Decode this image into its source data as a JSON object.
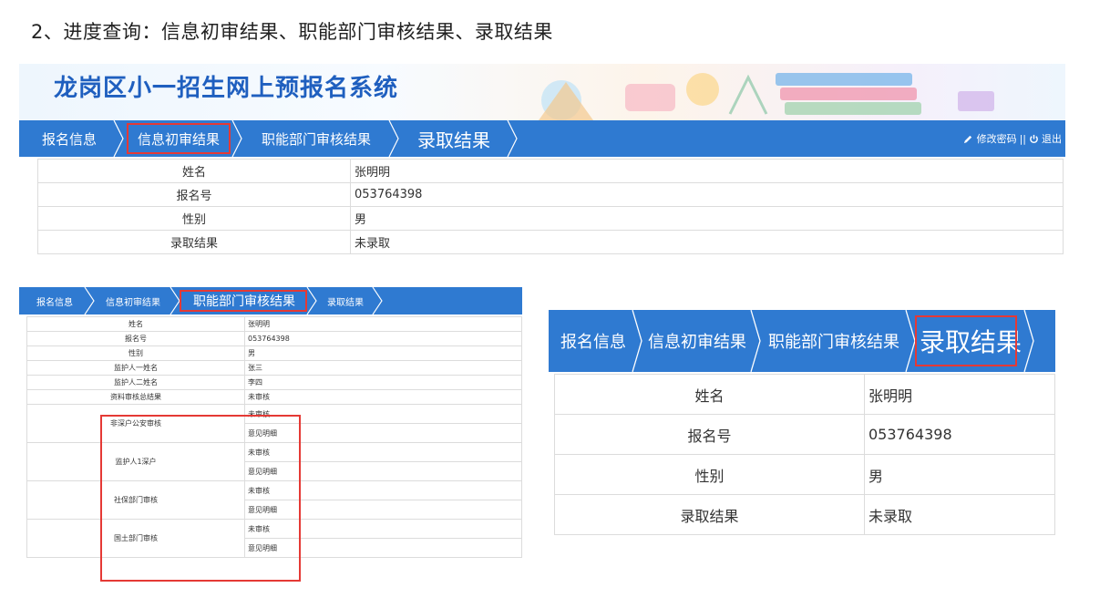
{
  "heading": "2、进度查询：信息初审结果、职能部门审核结果、录取结果",
  "system_title": "龙岗区小一招生网上预报名系统",
  "nav": {
    "tabs": [
      "报名信息",
      "信息初审结果",
      "职能部门审核结果",
      "录取结果"
    ],
    "change_password": "修改密码",
    "separator": "||",
    "logout": "退出"
  },
  "basic_info": [
    {
      "label": "姓名",
      "value": "张明明"
    },
    {
      "label": "报名号",
      "value": "053764398"
    },
    {
      "label": "性别",
      "value": "男"
    },
    {
      "label": "录取结果",
      "value": "未录取"
    }
  ],
  "dept_review": {
    "rows": [
      {
        "label": "姓名",
        "value": "张明明"
      },
      {
        "label": "报名号",
        "value": "053764398"
      },
      {
        "label": "性别",
        "value": "男"
      },
      {
        "label": "监护人一姓名",
        "value": "张三"
      },
      {
        "label": "监护人二姓名",
        "value": "李四"
      },
      {
        "label": "资料审核总结果",
        "value": "未审核"
      }
    ],
    "checks": [
      {
        "label": "非深户公安审核",
        "status": "未审核",
        "detail": "意见明细"
      },
      {
        "label": "监护人1深户",
        "status": "未审核",
        "detail": "意见明细"
      },
      {
        "label": "社保部门审核",
        "status": "未审核",
        "detail": "意见明细"
      },
      {
        "label": "国土部门审核",
        "status": "未审核",
        "detail": "意见明细"
      }
    ]
  },
  "colors": {
    "nav_blue": "#2f7ad1",
    "highlight_red": "#e53935",
    "title_blue": "#1f5fbf"
  }
}
